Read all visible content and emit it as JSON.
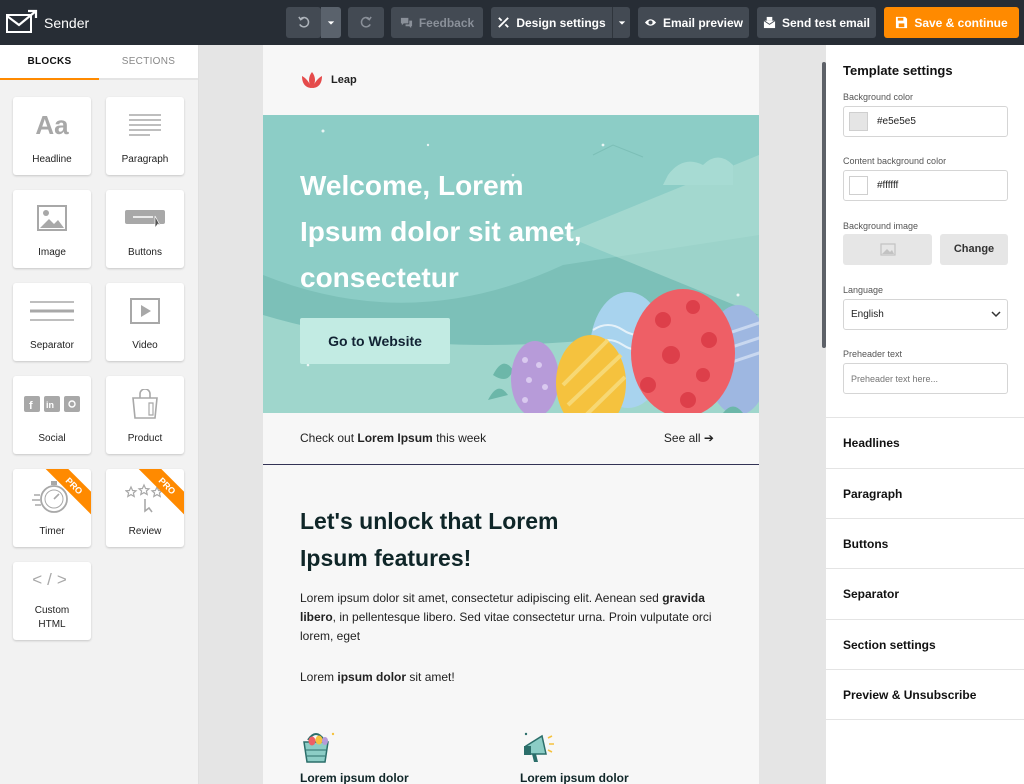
{
  "app": {
    "name": "Sender"
  },
  "toolbar": {
    "undo_icon": "undo-icon",
    "redo_icon": "redo-icon",
    "feedback_label": "Feedback",
    "design_settings_label": "Design settings",
    "email_preview_label": "Email preview",
    "send_test_label": "Send test email",
    "save_label": "Save & continue",
    "accent_color": "#ff8a00"
  },
  "left_panel": {
    "tabs": [
      "BLOCKS",
      "SECTIONS"
    ],
    "active_tab": "BLOCKS",
    "blocks": [
      {
        "label": "Headline",
        "icon": "headline-icon"
      },
      {
        "label": "Paragraph",
        "icon": "paragraph-icon"
      },
      {
        "label": "Image",
        "icon": "image-icon"
      },
      {
        "label": "Buttons",
        "icon": "button-icon"
      },
      {
        "label": "Separator",
        "icon": "separator-icon"
      },
      {
        "label": "Video",
        "icon": "video-icon"
      },
      {
        "label": "Social",
        "icon": "social-icon"
      },
      {
        "label": "Product",
        "icon": "shopping-bag-icon"
      },
      {
        "label": "Timer",
        "icon": "stopwatch-icon",
        "badge": "PRO"
      },
      {
        "label": "Review",
        "icon": "review-stars-icon",
        "badge": "PRO"
      },
      {
        "label": "Custom HTML",
        "icon": "code-icon"
      }
    ],
    "headline_glyph": "Aa",
    "code_glyph": "</>"
  },
  "email": {
    "brand": "Leap",
    "hero_title": "Welcome, Lorem Ipsum dolor sit amet, consectetur",
    "hero_button": "Go to Website",
    "strip_prefix": "Check out ",
    "strip_bold": "Lorem Ipsum",
    "strip_suffix": " this week",
    "strip_link": "See all ➔",
    "section_title": "Let's unlock that Lorem Ipsum features!",
    "para1_a": "Lorem ipsum dolor sit amet, consectetur adipiscing elit. Aenean sed ",
    "para1_bold": "gravida libero",
    "para1_b": ", in pellentesque libero. Sed vitae consectetur urna. Proin vulputate orci lorem, eget",
    "para2_a": "Lorem ",
    "para2_bold": "ipsum dolor",
    "para2_b": " sit amet!",
    "features": [
      "Lorem ipsum dolor",
      "Lorem ipsum dolor"
    ],
    "hero_color": "#8ccdc6"
  },
  "right_panel": {
    "title": "Template settings",
    "bg_color_label": "Background color",
    "bg_color_value": "#e5e5e5",
    "content_bg_label": "Content background color",
    "content_bg_value": "#ffffff",
    "bg_image_label": "Background image",
    "change_label": "Change",
    "language_label": "Language",
    "language_value": "English",
    "preheader_label": "Preheader text",
    "preheader_placeholder": "Preheader text here...",
    "sections": [
      "Headlines",
      "Paragraph",
      "Buttons",
      "Separator",
      "Section settings",
      "Preview & Unsubscribe"
    ]
  }
}
